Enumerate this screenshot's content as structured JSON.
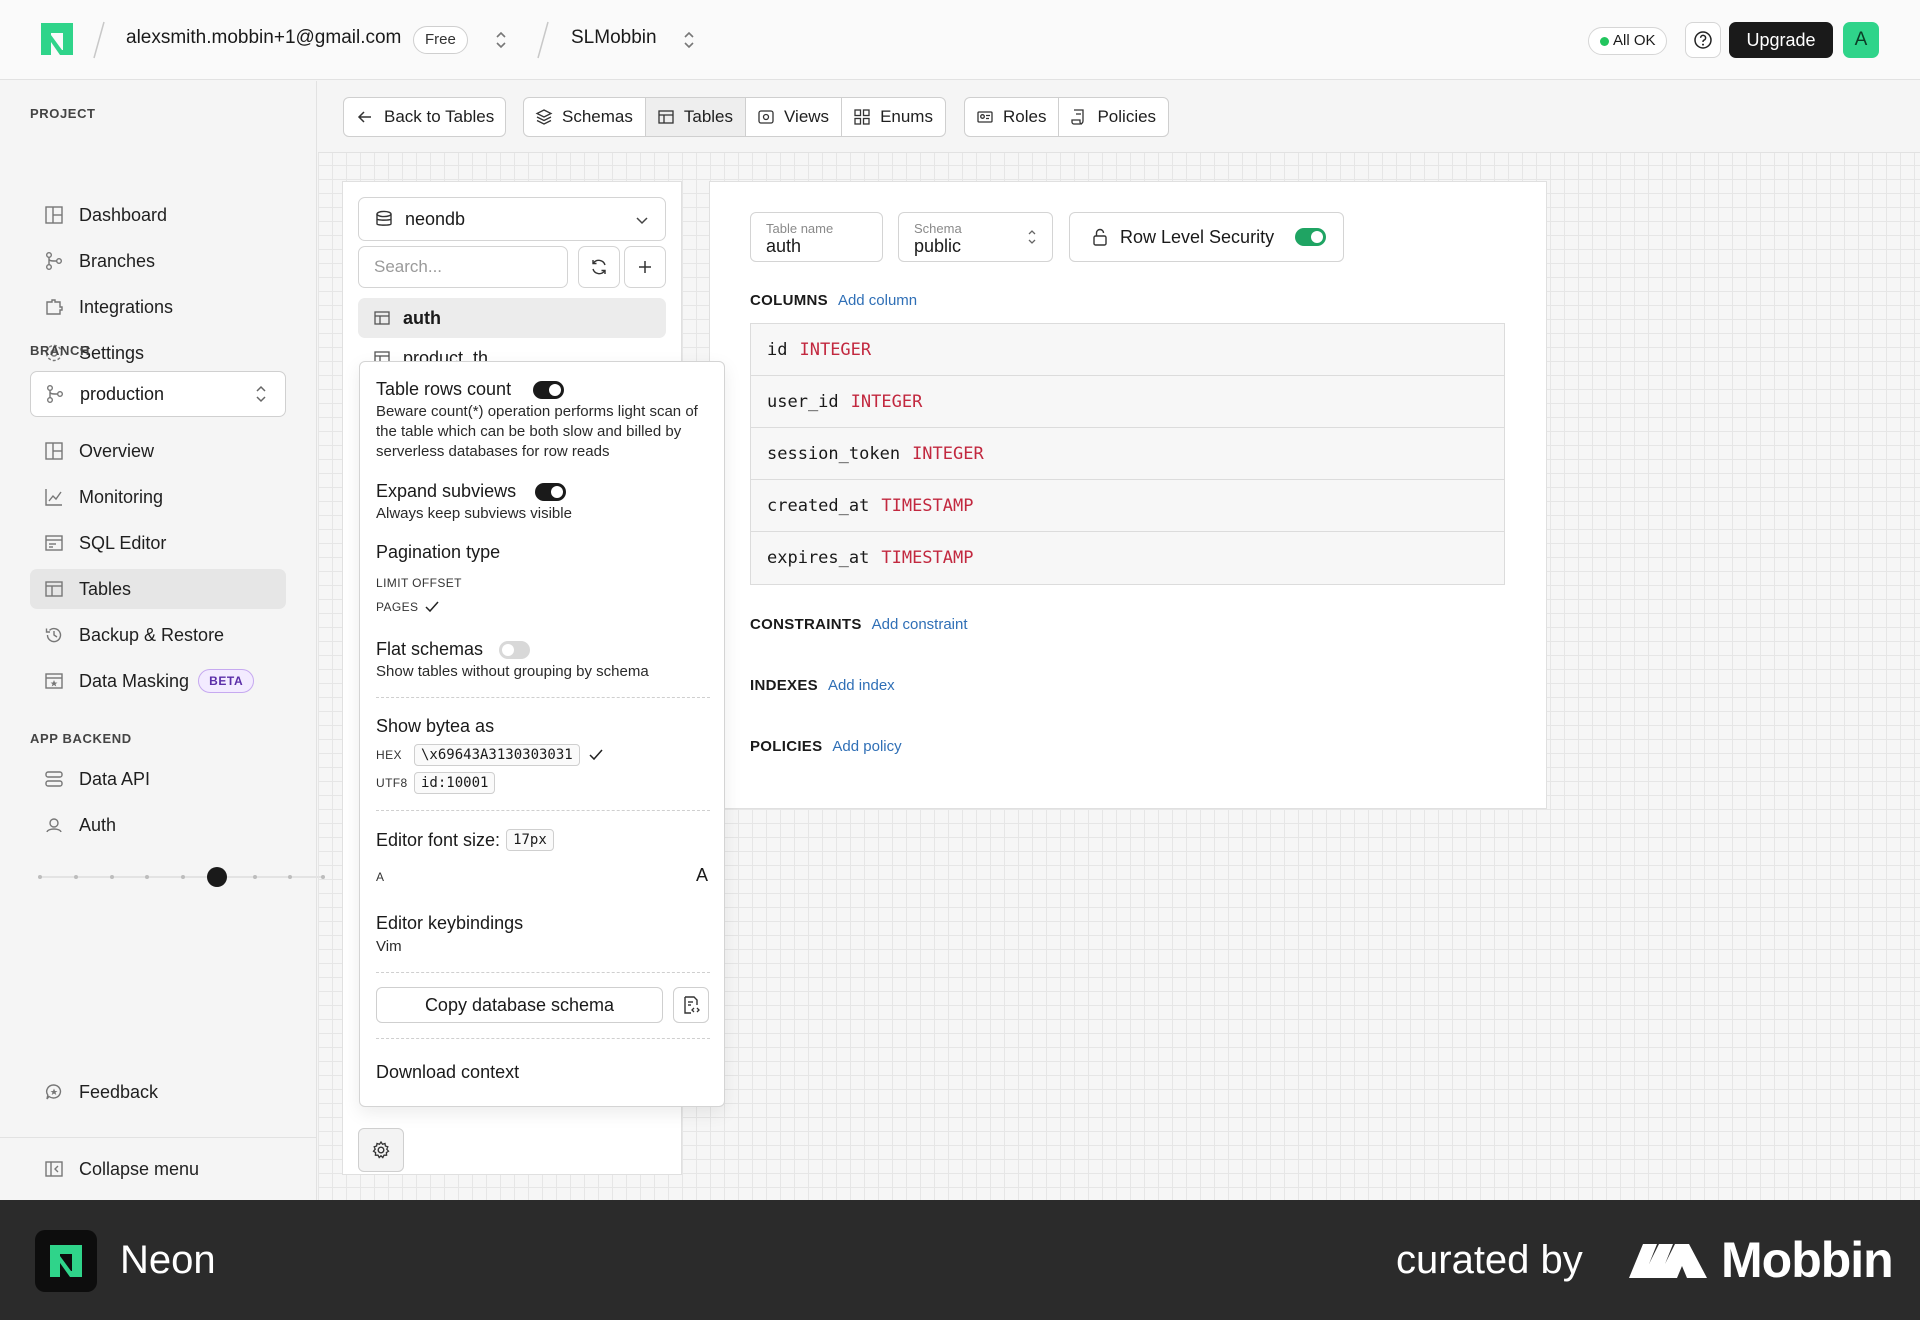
{
  "header": {
    "account_email": "alexsmith.mobbin+1@gmail.com",
    "plan_badge": "Free",
    "project_name": "SLMobbin",
    "status_label": "All OK",
    "upgrade_label": "Upgrade",
    "avatar_initial": "A"
  },
  "sidebar": {
    "project_section": "PROJECT",
    "project_items": [
      {
        "label": "Dashboard",
        "icon": "dashboard-icon"
      },
      {
        "label": "Branches",
        "icon": "branches-icon"
      },
      {
        "label": "Integrations",
        "icon": "integrations-icon"
      },
      {
        "label": "Settings",
        "icon": "settings-icon"
      }
    ],
    "branch_section": "BRANCH",
    "branch_selected": "production",
    "branch_items": [
      {
        "label": "Overview",
        "icon": "overview-icon"
      },
      {
        "label": "Monitoring",
        "icon": "monitoring-icon"
      },
      {
        "label": "SQL Editor",
        "icon": "sql-editor-icon"
      },
      {
        "label": "Tables",
        "icon": "tables-icon",
        "active": true
      },
      {
        "label": "Backup & Restore",
        "icon": "backup-icon"
      },
      {
        "label": "Data Masking",
        "icon": "data-masking-icon",
        "badge": "BETA"
      }
    ],
    "app_backend_section": "APP BACKEND",
    "app_backend_items": [
      {
        "label": "Data API",
        "icon": "data-api-icon"
      },
      {
        "label": "Auth",
        "icon": "auth-icon"
      }
    ],
    "feedback_label": "Feedback",
    "collapse_label": "Collapse menu"
  },
  "toolbar": {
    "back_label": "Back to Tables",
    "schemas_label": "Schemas",
    "tables_label": "Tables",
    "views_label": "Views",
    "enums_label": "Enums",
    "roles_label": "Roles",
    "policies_label": "Policies"
  },
  "db_panel": {
    "database": "neondb",
    "search_placeholder": "Search...",
    "tables": [
      "auth",
      "product_th"
    ],
    "active_table": "auth"
  },
  "settings_popover": {
    "rows_count_title": "Table rows count",
    "rows_count_desc": "Beware count(*) operation performs light scan of the table which can be both slow and billed by serverless databases for row reads",
    "rows_count_enabled": true,
    "expand_title": "Expand subviews",
    "expand_desc": "Always keep subviews visible",
    "expand_enabled": true,
    "pagination_title": "Pagination type",
    "pagination_opt1": "LIMIT OFFSET",
    "pagination_opt2": "PAGES",
    "pagination_selected": "PAGES",
    "flat_title": "Flat schemas",
    "flat_desc": "Show tables without grouping by schema",
    "flat_enabled": false,
    "bytea_title": "Show bytea as",
    "bytea_hex_label": "HEX",
    "bytea_hex_value": "\\x69643A3130303031",
    "bytea_utf8_label": "UTF8",
    "bytea_utf8_value": "id:10001",
    "bytea_selected": "HEX",
    "font_title": "Editor font size:",
    "font_value": "17px",
    "slider_min_label": "A",
    "slider_max_label": "A",
    "slider_level": 0.625,
    "keybind_title": "Editor keybindings",
    "keybind_value": "Vim",
    "copy_schema_label": "Copy database schema",
    "download_label": "Download context"
  },
  "table_editor": {
    "table_name_label": "Table name",
    "table_name_value": "auth",
    "schema_label": "Schema",
    "schema_value": "public",
    "rls_label": "Row Level Security",
    "rls_enabled": true,
    "columns_title": "COLUMNS",
    "add_column": "Add column",
    "columns": [
      {
        "name": "id",
        "type": "INTEGER"
      },
      {
        "name": "user_id",
        "type": "INTEGER"
      },
      {
        "name": "session_token",
        "type": "INTEGER"
      },
      {
        "name": "created_at",
        "type": "TIMESTAMP"
      },
      {
        "name": "expires_at",
        "type": "TIMESTAMP"
      }
    ],
    "constraints_title": "CONSTRAINTS",
    "add_constraint": "Add constraint",
    "indexes_title": "INDEXES",
    "add_index": "Add index",
    "policies_title": "POLICIES",
    "add_policy": "Add policy"
  },
  "footer": {
    "brand": "Neon",
    "curated_by": "curated by",
    "curator": "Mobbin"
  },
  "colors": {
    "accent_green": "#1fa463",
    "type_red": "#c2283f",
    "link_blue": "#2f6fb6",
    "beta_purple": "#5b2ea8"
  }
}
